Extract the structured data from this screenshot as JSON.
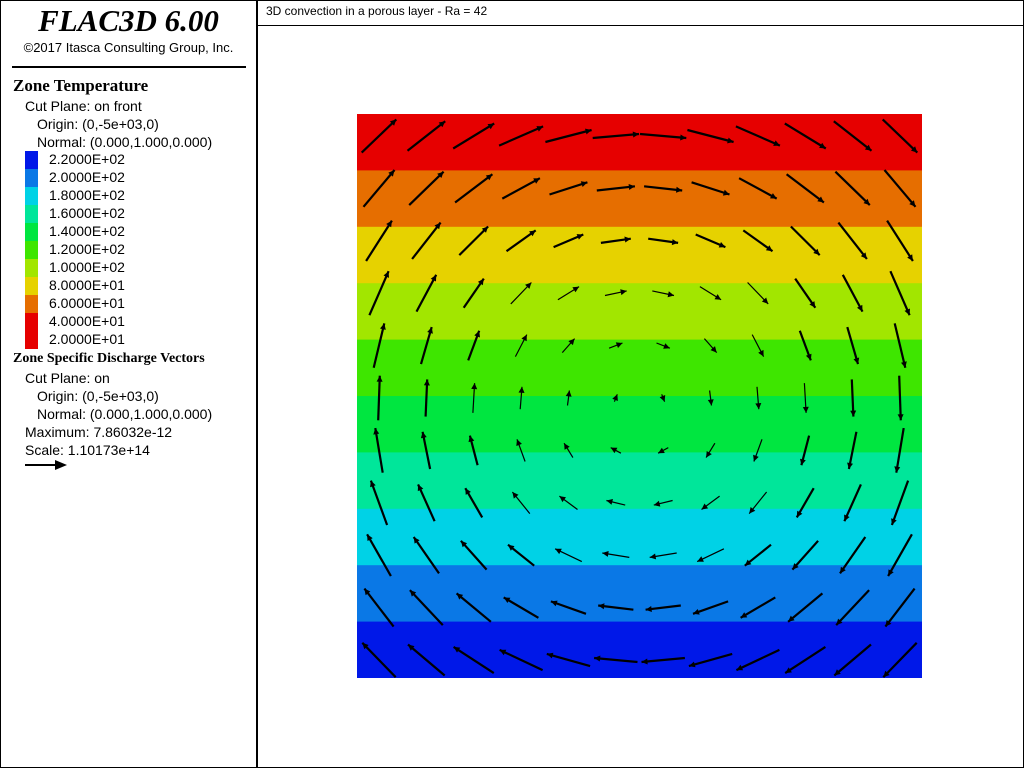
{
  "app": {
    "name": "FLAC3D 6.00",
    "copyright": "©2017 Itasca Consulting Group, Inc."
  },
  "plot": {
    "title": "3D convection in a porous layer - Ra = 42"
  },
  "legend": {
    "temperature": {
      "title": "Zone Temperature",
      "cut_plane": "Cut Plane: on front",
      "origin": "Origin: (0,-5e+03,0)",
      "normal": "Normal: (0.000,1.000,0.000)",
      "colorbar": [
        {
          "label": "2.2000E+02",
          "color": "#0018e8"
        },
        {
          "label": "2.0000E+02",
          "color": "#0a78e6"
        },
        {
          "label": "1.8000E+02",
          "color": "#00d2e6"
        },
        {
          "label": "1.6000E+02",
          "color": "#00e69a"
        },
        {
          "label": "1.4000E+02",
          "color": "#00e640"
        },
        {
          "label": "1.2000E+02",
          "color": "#3ee600"
        },
        {
          "label": "1.0000E+02",
          "color": "#a2e600"
        },
        {
          "label": "8.0000E+01",
          "color": "#e6d200"
        },
        {
          "label": "6.0000E+01",
          "color": "#e66e00"
        },
        {
          "label": "4.0000E+01",
          "color": "#e60000"
        },
        {
          "label": "2.0000E+01",
          "color": "#e60000"
        }
      ]
    },
    "vectors": {
      "title": "Zone Specific Discharge Vectors",
      "cut_plane": "Cut Plane: on",
      "origin": "Origin: (0,-5e+03,0)",
      "normal": "Normal: (0.000,1.000,0.000)",
      "maximum": "Maximum: 7.86032e-12",
      "scale": "Scale: 1.10173e+14"
    }
  },
  "field": {
    "bands_top_to_bottom": [
      "#e60000",
      "#e66e00",
      "#e6d200",
      "#a2e600",
      "#3ee600",
      "#00e640",
      "#00e69a",
      "#00d2e6",
      "#0a78e6",
      "#0018e8"
    ],
    "arrow_color": "#000000",
    "grid": 12
  }
}
